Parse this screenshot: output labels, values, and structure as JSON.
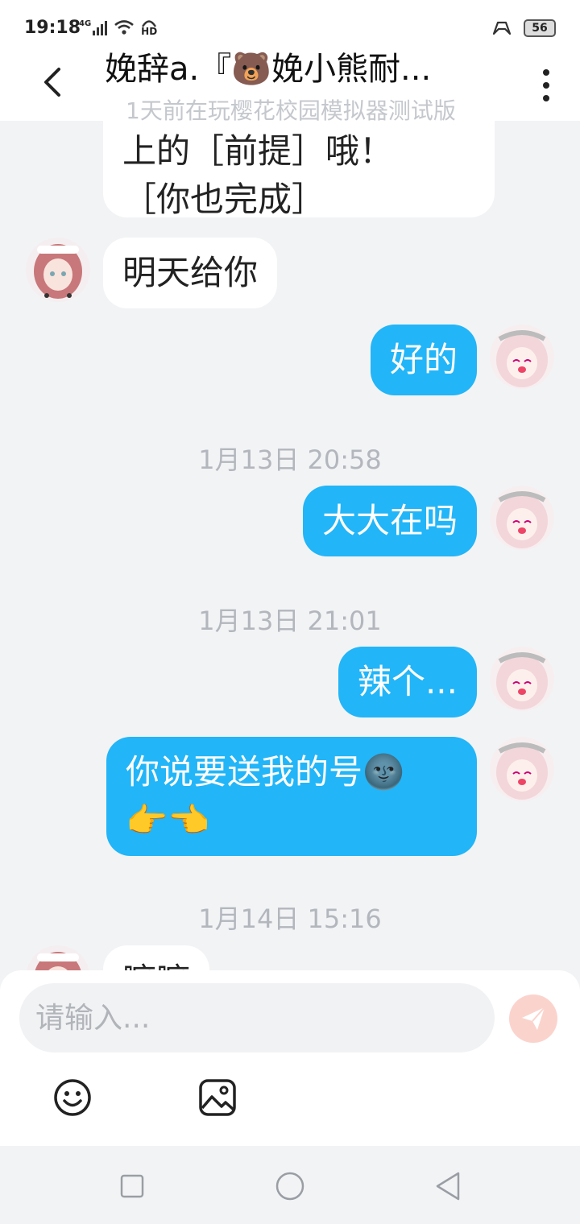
{
  "status_bar": {
    "time": "19:18",
    "network": "4G",
    "hd": "HD",
    "battery": "56"
  },
  "header": {
    "title": "娩辞a.『🐻娩小熊耐...",
    "subtitle": "1天前在玩樱花校园模拟器测试版",
    "back_icon": "chevron-left-icon",
    "more_icon": "more-vertical-icon"
  },
  "messages": [
    {
      "side": "in",
      "text_line1": "上的［前提］哦！",
      "text_line2": "［你也完成］"
    },
    {
      "side": "in",
      "text": "明天给你"
    },
    {
      "side": "out",
      "text": "好的"
    },
    {
      "type": "timestamp",
      "text": "1月13日 20:58"
    },
    {
      "side": "out",
      "text": "大大在吗"
    },
    {
      "type": "timestamp",
      "text": "1月13日 21:01"
    },
    {
      "side": "out",
      "text": "辣个..."
    },
    {
      "side": "out",
      "text_line1": "你说要送我的号🌚",
      "text_line2": "👉👈"
    },
    {
      "type": "timestamp",
      "text": "1月14日 15:16"
    },
    {
      "side": "in",
      "text": "嘛嘛"
    }
  ],
  "input": {
    "placeholder": "请输入..."
  },
  "toolbar": {
    "emoji_icon": "smiley-icon",
    "image_icon": "image-icon",
    "send_icon": "send-icon"
  },
  "colors": {
    "outgoing_bubble": "#22b5f8",
    "incoming_bubble": "#ffffff",
    "background": "#f2f3f5",
    "send_button": "#fbd3cd"
  }
}
